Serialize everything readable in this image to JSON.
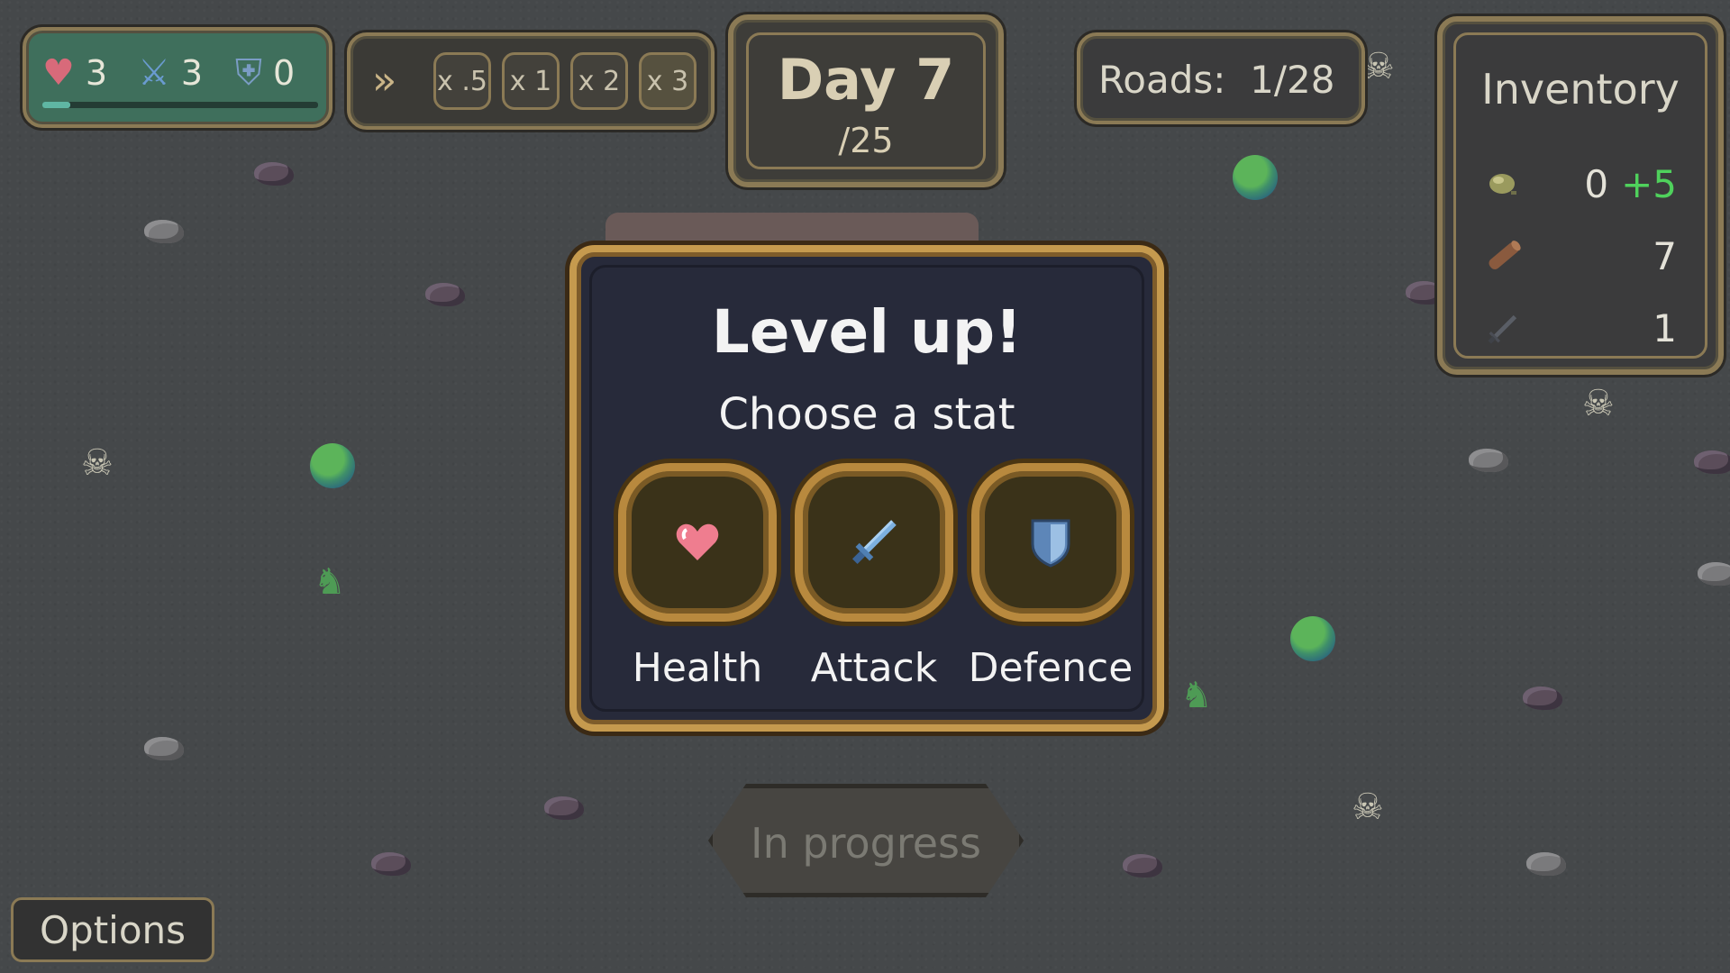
{
  "stats": {
    "health": "3",
    "attack": "3",
    "defence": "0",
    "xp_progress": 0.1
  },
  "speed": {
    "options": [
      "x .5",
      "x 1",
      "x 2",
      "x 3"
    ]
  },
  "day": {
    "label": "Day 7",
    "total": "/25"
  },
  "roads": {
    "label": "Roads:  1/28"
  },
  "inventory": {
    "title": "Inventory",
    "items": [
      {
        "icon": "ore-icon",
        "count": "0",
        "gain": "+5"
      },
      {
        "icon": "log-icon",
        "count": "7"
      },
      {
        "icon": "sword-icon",
        "count": "1"
      }
    ]
  },
  "levelup": {
    "title": "Level up!",
    "subtitle": "Choose a stat",
    "choices": [
      {
        "label": "Health",
        "icon": "heart-icon"
      },
      {
        "label": "Attack",
        "icon": "sword-icon"
      },
      {
        "label": "Defence",
        "icon": "shield-icon"
      }
    ]
  },
  "progress_button": {
    "label": "In progress"
  },
  "options_button": {
    "label": "Options"
  },
  "colors": {
    "accent_gold": "#c59a4e",
    "modal_bg": "#272a3a",
    "gain_green": "#4fd15c"
  }
}
